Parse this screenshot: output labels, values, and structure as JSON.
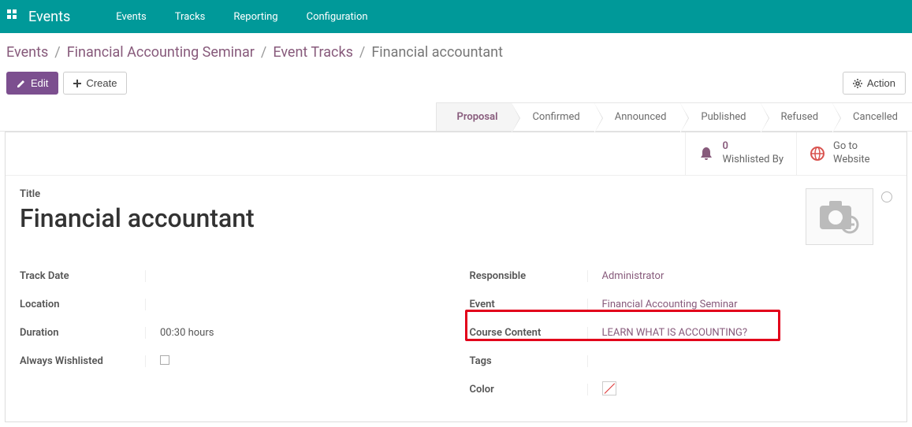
{
  "topbar": {
    "app_title": "Events",
    "menu": [
      "Events",
      "Tracks",
      "Reporting",
      "Configuration"
    ]
  },
  "breadcrumb": {
    "items": [
      "Events",
      "Financial Accounting Seminar",
      "Event Tracks"
    ],
    "current": "Financial accountant"
  },
  "toolbar": {
    "edit": "Edit",
    "create": "Create",
    "action": "Action"
  },
  "status_steps": [
    "Proposal",
    "Confirmed",
    "Announced",
    "Published",
    "Refused",
    "Cancelled"
  ],
  "status_active": 0,
  "stat_buttons": {
    "wishlisted": {
      "count": "0",
      "label": "Wishlisted By"
    },
    "website": {
      "line1": "Go to",
      "line2": "Website"
    }
  },
  "form": {
    "title_label": "Title",
    "title_value": "Financial accountant",
    "left": {
      "track_date": {
        "label": "Track Date",
        "value": ""
      },
      "location": {
        "label": "Location",
        "value": ""
      },
      "duration": {
        "label": "Duration",
        "value": "00:30 hours"
      },
      "always_wishlisted": {
        "label": "Always Wishlisted"
      }
    },
    "right": {
      "responsible": {
        "label": "Responsible",
        "value": "Administrator"
      },
      "event": {
        "label": "Event",
        "value": "Financial Accounting Seminar"
      },
      "course_content": {
        "label": "Course Content",
        "value": "LEARN WHAT IS ACCOUNTING?"
      },
      "tags": {
        "label": "Tags",
        "value": ""
      },
      "color": {
        "label": "Color"
      }
    }
  }
}
